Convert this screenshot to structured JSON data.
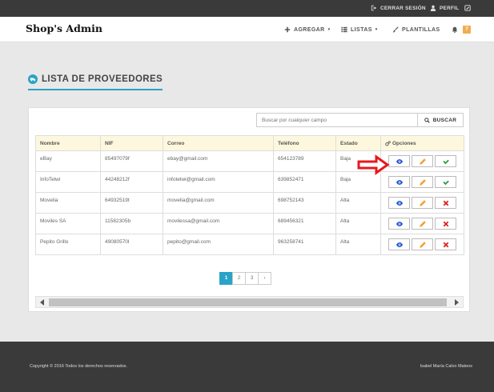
{
  "topbar": {
    "logout_label": "CERRAR SESIÓN",
    "profile_label": "PERFIL"
  },
  "navbar": {
    "brand": "Shop's Admin",
    "menu": [
      {
        "label": "AGREGAR",
        "icon": "plus-icon"
      },
      {
        "label": "LISTAS",
        "icon": "list-icon"
      },
      {
        "label": "PLANTILLAS",
        "icon": "brush-icon"
      }
    ],
    "notifications_count": "7"
  },
  "page": {
    "title": "LISTA DE PROVEEDORES"
  },
  "search": {
    "placeholder": "Buscar por cualquier campo",
    "button_label": "BUSCAR"
  },
  "table": {
    "columns": [
      "Nombre",
      "NIF",
      "Correo",
      "Teléfono",
      "Estado",
      "Opciones"
    ],
    "rows": [
      {
        "nombre": "eBay",
        "nif": "85497079f",
        "correo": "ebay@gmail.com",
        "telefono": "654123789",
        "estado": "Baja",
        "status_action": "activate"
      },
      {
        "nombre": "InfoTelwi",
        "nif": "44248212f",
        "correo": "infotelwi@gmail.com",
        "telefono": "639852471",
        "estado": "Baja",
        "status_action": "activate"
      },
      {
        "nombre": "Movelia",
        "nif": "64932519t",
        "correo": "movelia@gmail.com",
        "telefono": "698752143",
        "estado": "Alta",
        "status_action": "deactivate"
      },
      {
        "nombre": "Moviles SA",
        "nif": "11582305b",
        "correo": "movilessa@gmail.com",
        "telefono": "689456321",
        "estado": "Alta",
        "status_action": "deactivate"
      },
      {
        "nombre": "Pepito Grillo",
        "nif": "49080570l",
        "correo": "pepito@gmail.com",
        "telefono": "963258741",
        "estado": "Alta",
        "status_action": "deactivate"
      }
    ]
  },
  "pagination": {
    "pages": [
      "1",
      "2",
      "3"
    ],
    "active": "1",
    "next": "›"
  },
  "footer": {
    "copyright": "Copyright © 2016 Todos los derechos reservados.",
    "author": "Isabel María Calvo Mateos"
  },
  "colors": {
    "accent": "#29a3c7",
    "header_row": "#fdf8dd",
    "dark_bar": "#3a3a3a",
    "view_icon": "#1a4fd6",
    "edit_icon": "#f0a030",
    "activate_icon": "#2a9a3a",
    "deactivate_icon": "#e02020",
    "annotation_arrow": "#e8181c"
  }
}
